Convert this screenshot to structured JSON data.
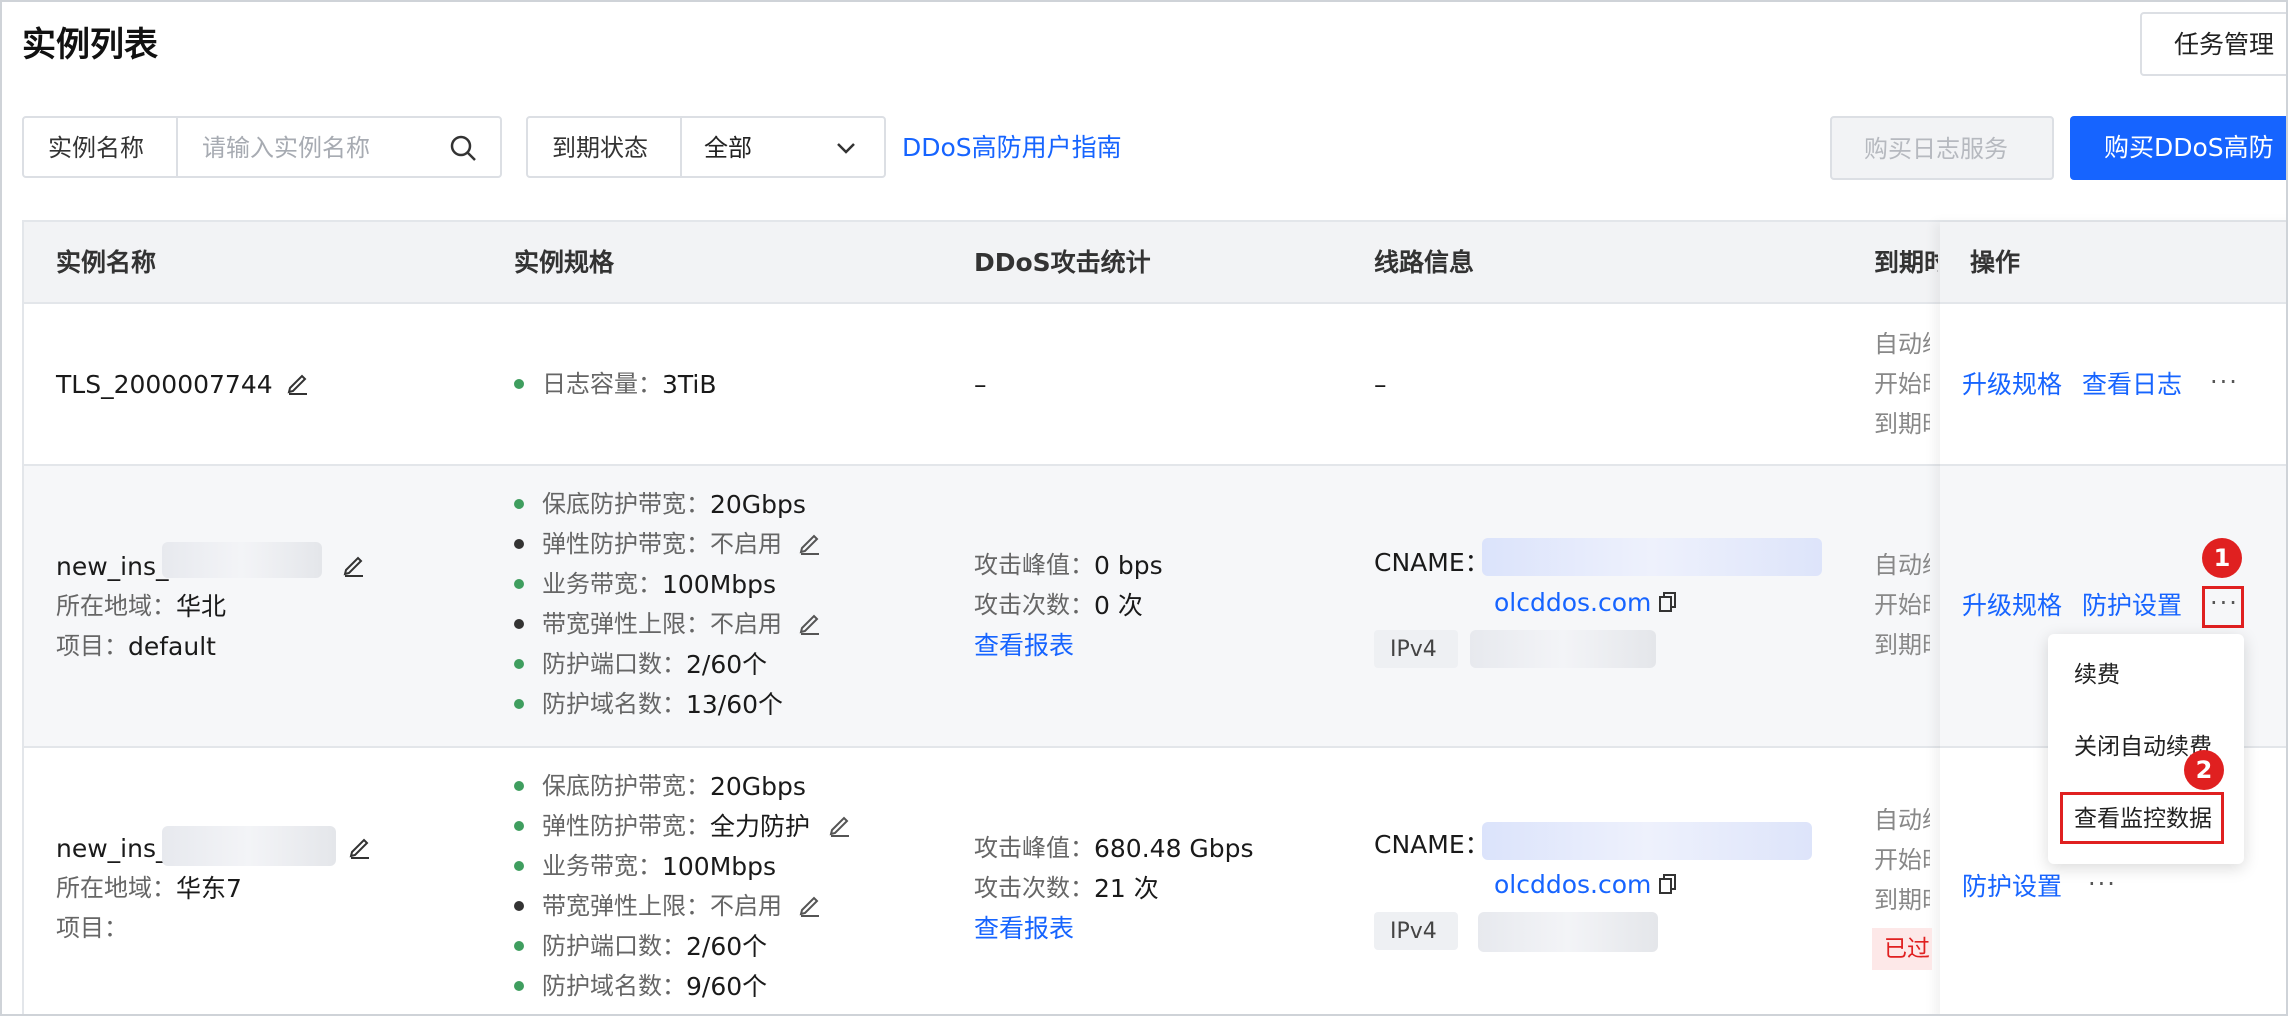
{
  "page": {
    "title": "实例列表",
    "task_button": "任务管理"
  },
  "filters": {
    "name_label": "实例名称",
    "name_placeholder": "请输入实例名称",
    "expire_label": "到期状态",
    "expire_value": "全部",
    "guide_link": "DDoS高防用户指南",
    "buy_log_button": "购买日志服务",
    "buy_ddos_button": "购买DDoS高防"
  },
  "table": {
    "headers": {
      "name": "实例名称",
      "spec": "实例规格",
      "attack": "DDoS攻击统计",
      "line": "线路信息",
      "expire": "到期时",
      "ops": "操作"
    },
    "rows": [
      {
        "name": "TLS_2000007744",
        "spec": [
          {
            "label": "日志容量：",
            "value": "3TiB"
          }
        ],
        "attack": "–",
        "line": "–",
        "expire": [
          "自动续",
          "开始时",
          "到期时"
        ],
        "actions": [
          "升级规格",
          "查看日志"
        ],
        "more": "···"
      },
      {
        "name": "new_ins_",
        "region_label": "所在地域：",
        "region": "华北",
        "project_label": "项目：",
        "project": "default",
        "spec": [
          {
            "label": "保底防护带宽：",
            "value": "20Gbps"
          },
          {
            "label": "弹性防护带宽：",
            "value": "不启用"
          },
          {
            "label": "业务带宽：",
            "value": "100Mbps"
          },
          {
            "label": "带宽弹性上限：",
            "value": "不启用"
          },
          {
            "label": "防护端口数：",
            "value": "2/60个"
          },
          {
            "label": "防护域名数：",
            "value": "13/60个"
          }
        ],
        "attack_peak_label": "攻击峰值：",
        "attack_peak": "0 bps",
        "attack_count_label": "攻击次数：",
        "attack_count": "0 次",
        "report_link": "查看报表",
        "cname_label": "CNAME：",
        "cname_domain": "olcddos.com",
        "ip_tag": "IPv4",
        "expire": [
          "自动续",
          "开始时",
          "到期时"
        ],
        "actions": [
          "升级规格",
          "防护设置"
        ],
        "more": "···"
      },
      {
        "name": "new_ins_",
        "region_label": "所在地域：",
        "region": "华东7",
        "project_label": "项目：",
        "project": "",
        "spec": [
          {
            "label": "保底防护带宽：",
            "value": "20Gbps"
          },
          {
            "label": "弹性防护带宽：",
            "value": "全力防护"
          },
          {
            "label": "业务带宽：",
            "value": "100Mbps"
          },
          {
            "label": "带宽弹性上限：",
            "value": "不启用"
          },
          {
            "label": "防护端口数：",
            "value": "2/60个"
          },
          {
            "label": "防护域名数：",
            "value": "9/60个"
          }
        ],
        "attack_peak_label": "攻击峰值：",
        "attack_peak": "680.48 Gbps",
        "attack_count_label": "攻击次数：",
        "attack_count": "21 次",
        "report_link": "查看报表",
        "cname_label": "CNAME：",
        "cname_domain": "olcddos.com",
        "ip_tag": "IPv4",
        "expire": [
          "自动续",
          "开始时",
          "到期时"
        ],
        "expired_badge": "已过",
        "actions": [
          "防护设置"
        ],
        "more": "···"
      }
    ]
  },
  "dropdown_menu": [
    "续费",
    "关闭自动续费",
    "查看监控数据"
  ],
  "annotations": {
    "step1": "1",
    "step2": "2"
  },
  "colors": {
    "accent": "#1664ff",
    "annotation": "#e02020",
    "dot_green": "#3f9e5f"
  }
}
